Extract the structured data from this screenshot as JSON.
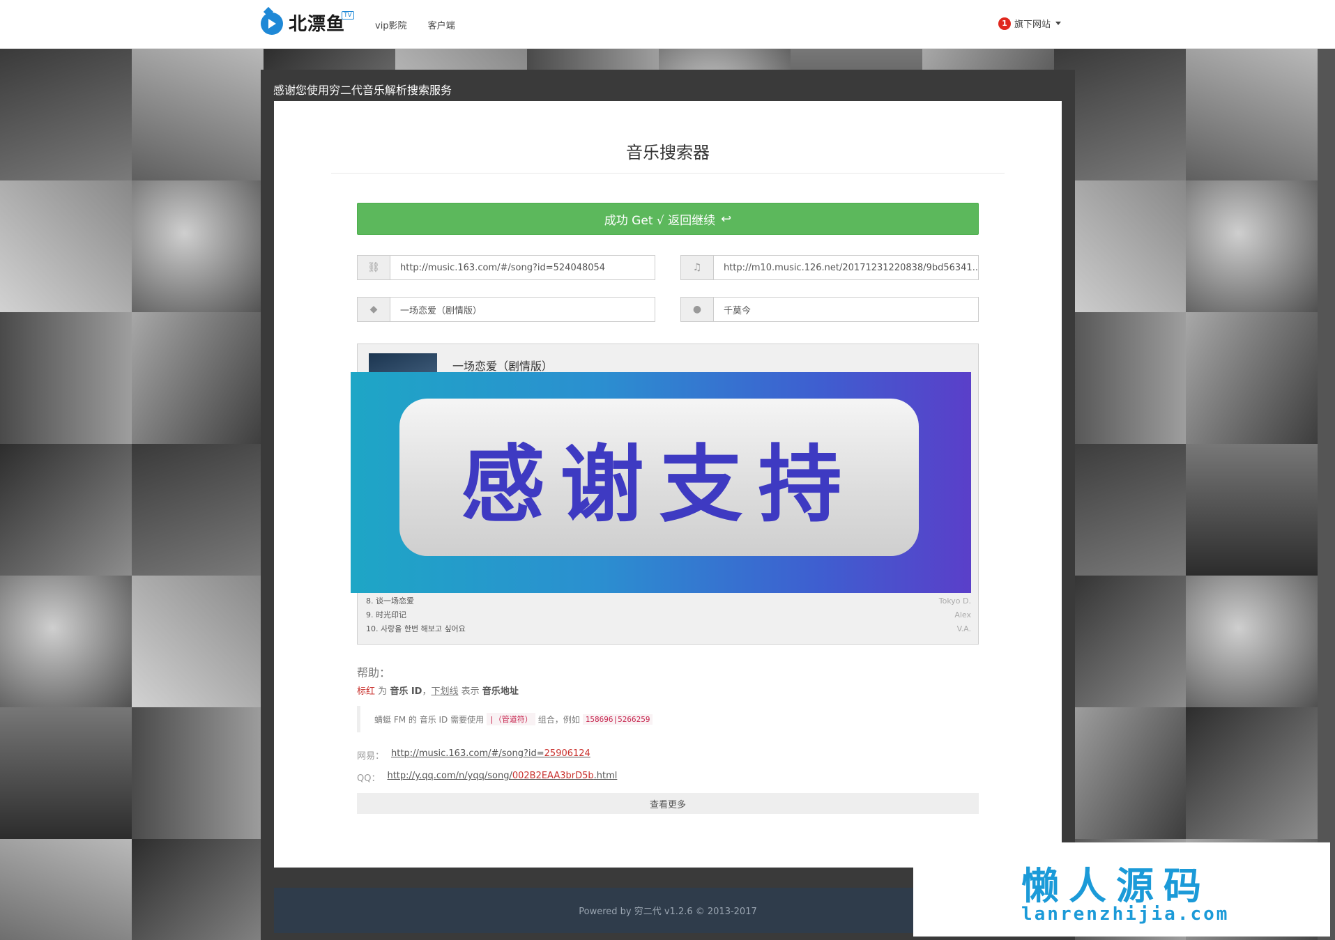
{
  "navbar": {
    "brand": "北漂鱼",
    "brand_tag": "TV",
    "links": [
      "vip影院",
      "客户端"
    ],
    "right_badge": "1",
    "right_label": "旗下网站"
  },
  "wrapper": {
    "title": "感谢您使用穷二代音乐解析搜索服务"
  },
  "main": {
    "page_title": "音乐搜索器",
    "success_button": "成功 Get √ 返回继续",
    "fields": {
      "song_url": "http://music.163.com/#/song?id=524048054",
      "music_url": "http://m10.music.126.net/20171231220838/9bd56341...",
      "song_name": "一场恋爱（剧情版）",
      "artist": "千莫今"
    },
    "player": {
      "title": "一场恋爱（剧情版）",
      "tracks": [
        {
          "title": "8. 谈一场恋爱",
          "artist": "Tokyo D."
        },
        {
          "title": "9. 时光印记",
          "artist": "Alex"
        },
        {
          "title": "10. 사랑을 한번 해보고 싶어요",
          "artist": "V.A."
        }
      ]
    },
    "help": {
      "title": "帮助：",
      "red_word": "标红",
      "text_1": "为",
      "bold_1": "音乐 ID",
      "text_2": "，",
      "underline_word": "下划线",
      "text_3": "表示",
      "bold_2": "音乐地址",
      "quote_text_1": "蜻蜓 FM 的 音乐 ID 需要使用",
      "quote_code_1": "|（管道符）",
      "quote_text_2": "组合，例如",
      "quote_code_2": "158696|5266259",
      "examples": [
        {
          "label": "网易：",
          "url_prefix": "http://music.163.com/#/song?id=",
          "id": "25906124",
          "url_suffix": ""
        },
        {
          "label": "QQ：",
          "url_prefix": "http://y.qq.com/n/yqq/song/",
          "id": "002B2EAA3brD5b",
          "url_suffix": ".html"
        }
      ],
      "more_button": "查看更多"
    }
  },
  "banner": {
    "text": "感谢支持"
  },
  "footer": {
    "text": "Powered by 穷二代 v1.2.6 © 2013-2017"
  },
  "watermark": {
    "cn": "懒人源码",
    "en": "lanrenzhijia.com"
  }
}
